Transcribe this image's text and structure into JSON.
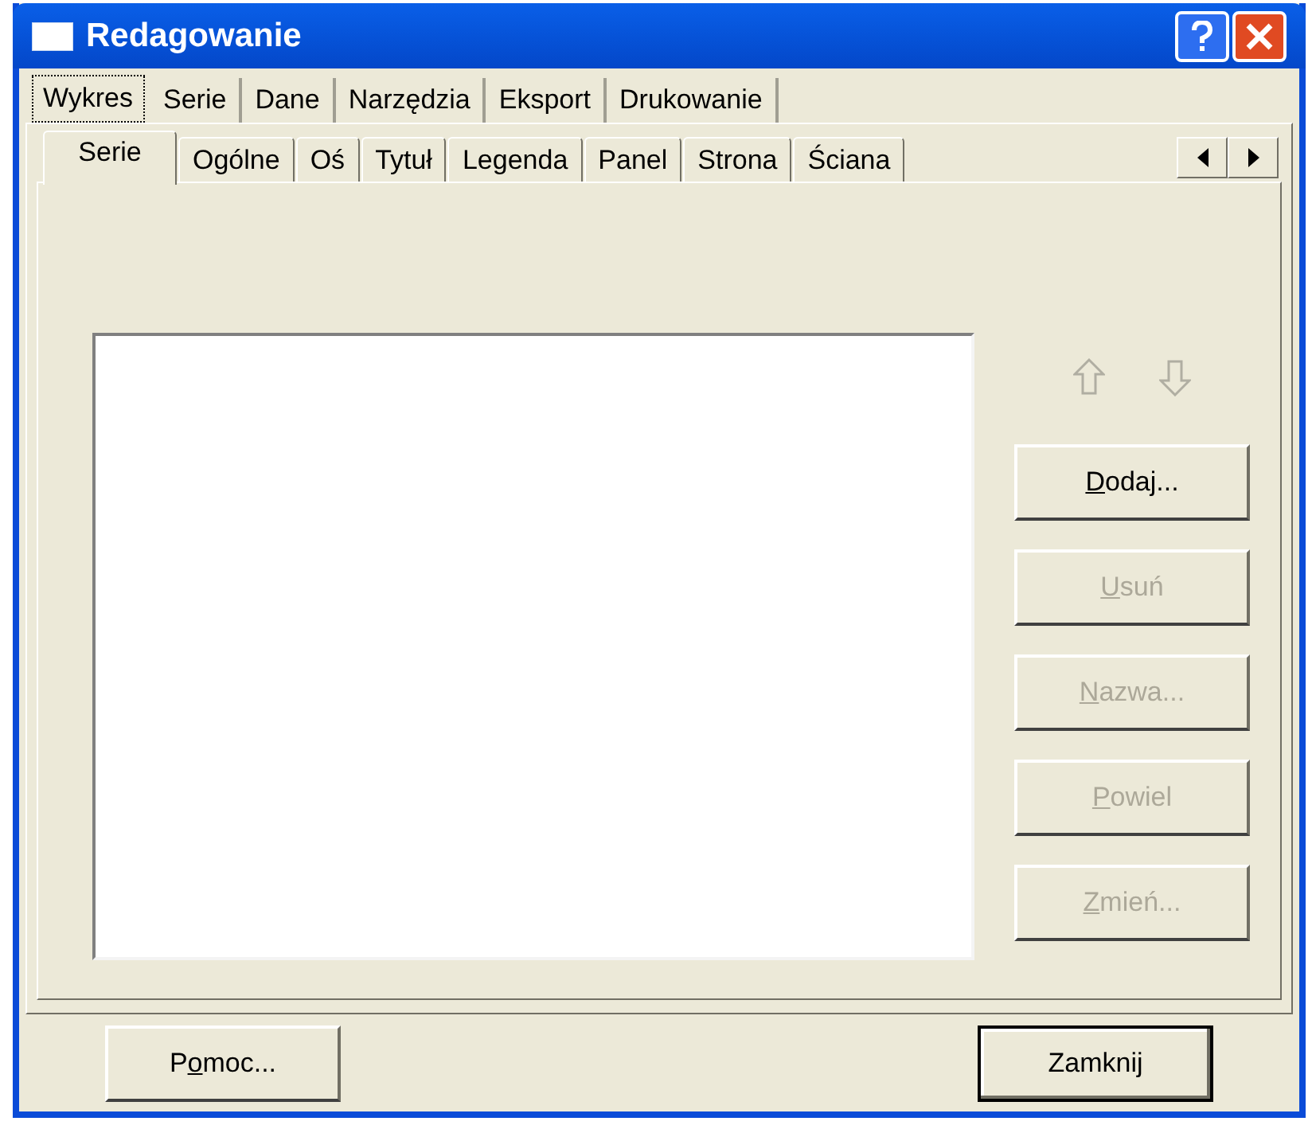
{
  "window": {
    "title": "Redagowanie"
  },
  "tabs": [
    {
      "label": "Wykres",
      "selected": true
    },
    {
      "label": "Serie",
      "selected": false
    },
    {
      "label": "Dane",
      "selected": false
    },
    {
      "label": "Narzędzia",
      "selected": false
    },
    {
      "label": "Eksport",
      "selected": false
    },
    {
      "label": "Drukowanie",
      "selected": false
    }
  ],
  "subtabs": [
    {
      "label": "Serie",
      "selected": true
    },
    {
      "label": "Ogólne",
      "selected": false
    },
    {
      "label": "Oś",
      "selected": false
    },
    {
      "label": "Tytuł",
      "selected": false
    },
    {
      "label": "Legenda",
      "selected": false
    },
    {
      "label": "Panel",
      "selected": false
    },
    {
      "label": "Strona",
      "selected": false
    },
    {
      "label": "Ściana",
      "selected": false
    }
  ],
  "series_buttons": [
    {
      "accel": "D",
      "after": "odaj...",
      "disabled": false
    },
    {
      "accel": "U",
      "after": "suń",
      "disabled": true
    },
    {
      "accel": "N",
      "after": "azwa...",
      "disabled": true
    },
    {
      "accel": "P",
      "after": "owiel",
      "disabled": true
    },
    {
      "accel": "Z",
      "after": "mień...",
      "disabled": true
    }
  ],
  "footer_buttons": [
    {
      "before": "P",
      "accel": "o",
      "after": "moc...",
      "default": false
    },
    {
      "before": "Zamknij",
      "default": true
    }
  ]
}
